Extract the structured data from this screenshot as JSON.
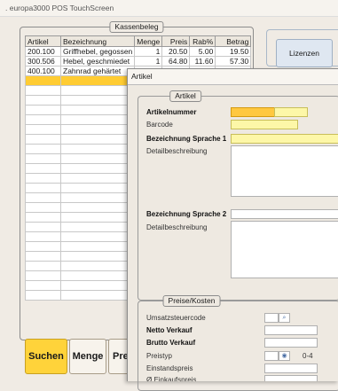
{
  "app": {
    "title": ". europa3000 POS TouchScreen"
  },
  "kassenbeleg": {
    "title": "Kassenbeleg",
    "columns": [
      "Artikel",
      "Bezeichnung",
      "Menge",
      "Preis",
      "Rab%",
      "Betrag"
    ],
    "rows": [
      [
        "200.100",
        "Griffhebel, gegossen",
        "1",
        "20.50",
        "5.00",
        "19.50"
      ],
      [
        "300.506",
        "Hebel, geschmiedet",
        "1",
        "64.80",
        "11.60",
        "57.30"
      ],
      [
        "400.100",
        "Zahnrad gehärtet",
        "",
        "",
        "",
        ""
      ]
    ]
  },
  "buttons": {
    "suchen": "Suchen",
    "menge": "Menge",
    "preis": "Prei"
  },
  "right_panel": {
    "lizenzen": "Lizenzen"
  },
  "artikel_dialog": {
    "window_title": "Artikel",
    "section_artikel": "Artikel",
    "artikelnummer_label": "Artikelnummer",
    "barcode_label": "Barcode",
    "bez1_label": "Bezeichnung Sprache 1",
    "detail1_label": "Detailbeschreibung",
    "bez2_label": "Bezeichnung Sprache 2",
    "detail2_label": "Detailbeschreibung",
    "section_preise": "Preise/Kosten",
    "ust_label": "Umsatzsteuercode",
    "netto_label": "Netto Verkauf",
    "brutto_label": "Brutto Verkauf",
    "preistyp_label": "Preistyp",
    "preistyp_range": "0-4",
    "einstand_label": "Einstandspreis",
    "einkauf_label": "Ø Einkaufspreis"
  },
  "icons": {
    "lookup": "magnifier-icon",
    "spinner": "spinner-icon"
  },
  "colors": {
    "selection": "#ffcc33",
    "required_field": "#fdf7a8",
    "active_field": "#ffc840",
    "suchen_button": "#ffd33a"
  }
}
